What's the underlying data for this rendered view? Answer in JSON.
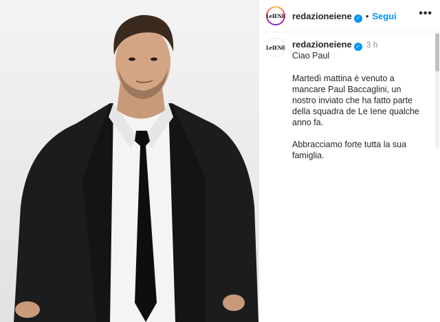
{
  "post": {
    "image_alt": "Man in black suit, white shirt and black tie",
    "account": {
      "username": "redazioneiene",
      "avatar_text": "LeIENE",
      "follow_label": "Segui",
      "dot": "•",
      "more_label": "•••"
    },
    "caption": {
      "time": "3 h",
      "greeting": "Ciao Paul",
      "heart": "♡",
      "paragraph_1": "Martedì mattina è venuto a mancare Paul Baccaglini, un nostro inviato che ha fatto parte della squadra de Le Iene qualche anno fa.",
      "paragraph_2": "Abbracciamo forte tutta la sua famiglia."
    }
  },
  "colors": {
    "link_blue": "#0095f6",
    "text": "#262626",
    "muted": "#8e8e8e",
    "border": "#efefef"
  },
  "icons": {
    "verified": "verified-badge-icon",
    "more": "more-options-icon",
    "heart": "white-heart-icon"
  }
}
